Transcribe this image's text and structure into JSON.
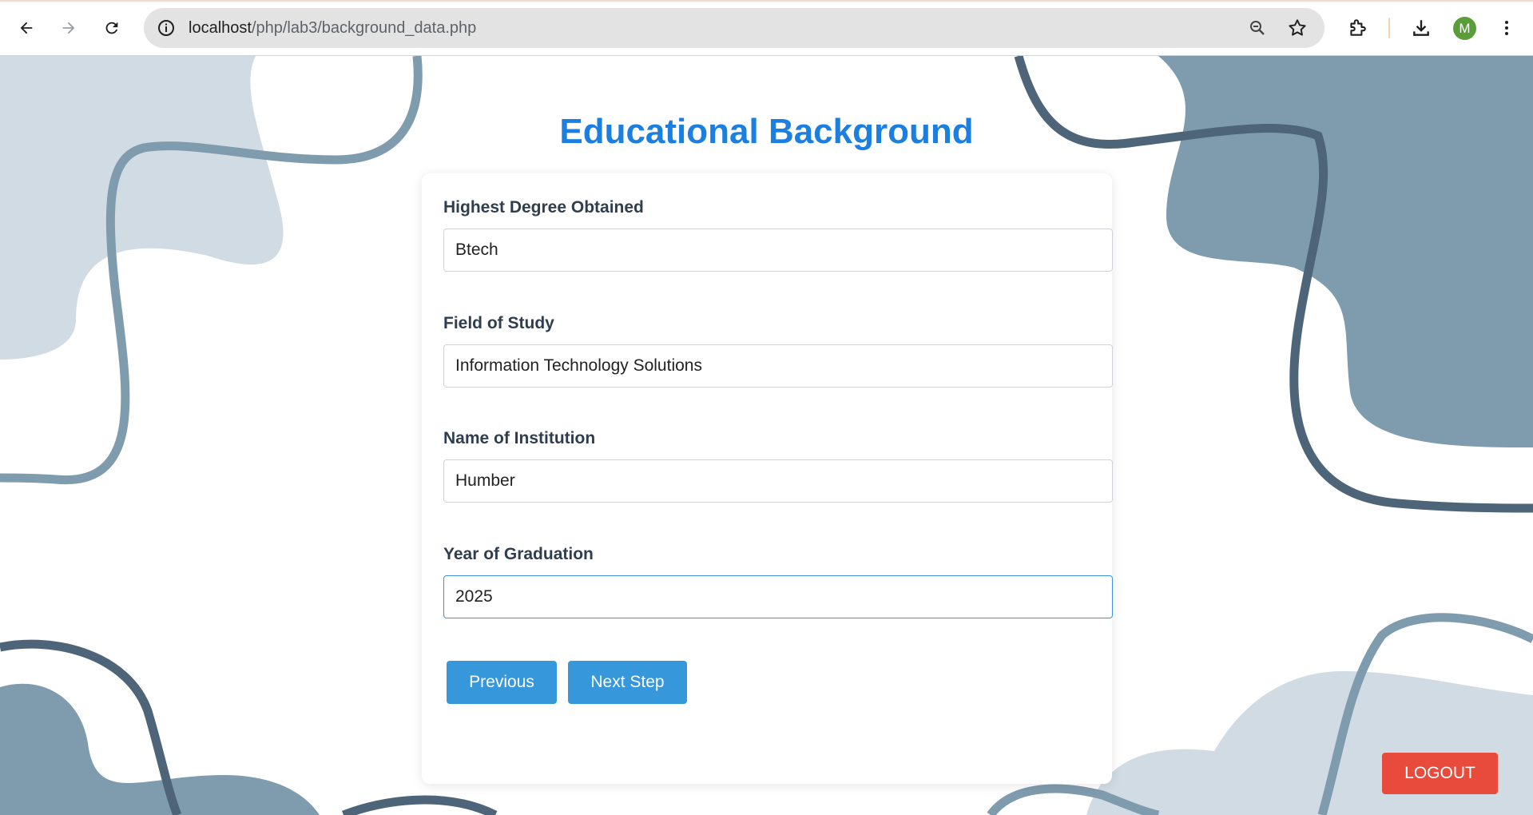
{
  "browser": {
    "url_host": "localhost",
    "url_path": "/php/lab3/background_data.php",
    "profile_initial": "M"
  },
  "page": {
    "title": "Educational Background",
    "fields": [
      {
        "label": "Highest Degree Obtained",
        "value": "Btech"
      },
      {
        "label": "Field of Study",
        "value": "Information Technology Solutions"
      },
      {
        "label": "Name of Institution",
        "value": "Humber"
      },
      {
        "label": "Year of Graduation",
        "value": "2025"
      }
    ],
    "buttons": {
      "previous": "Previous",
      "next": "Next Step",
      "logout": "LOGOUT"
    }
  },
  "colors": {
    "title": "#1a7fe0",
    "button": "#3797db",
    "logout": "#e84b3c",
    "blob_light": "#d0dbe3",
    "blob_mid": "#7f9bae",
    "line_dark": "#4e6579",
    "line_mid": "#7f9bae"
  }
}
